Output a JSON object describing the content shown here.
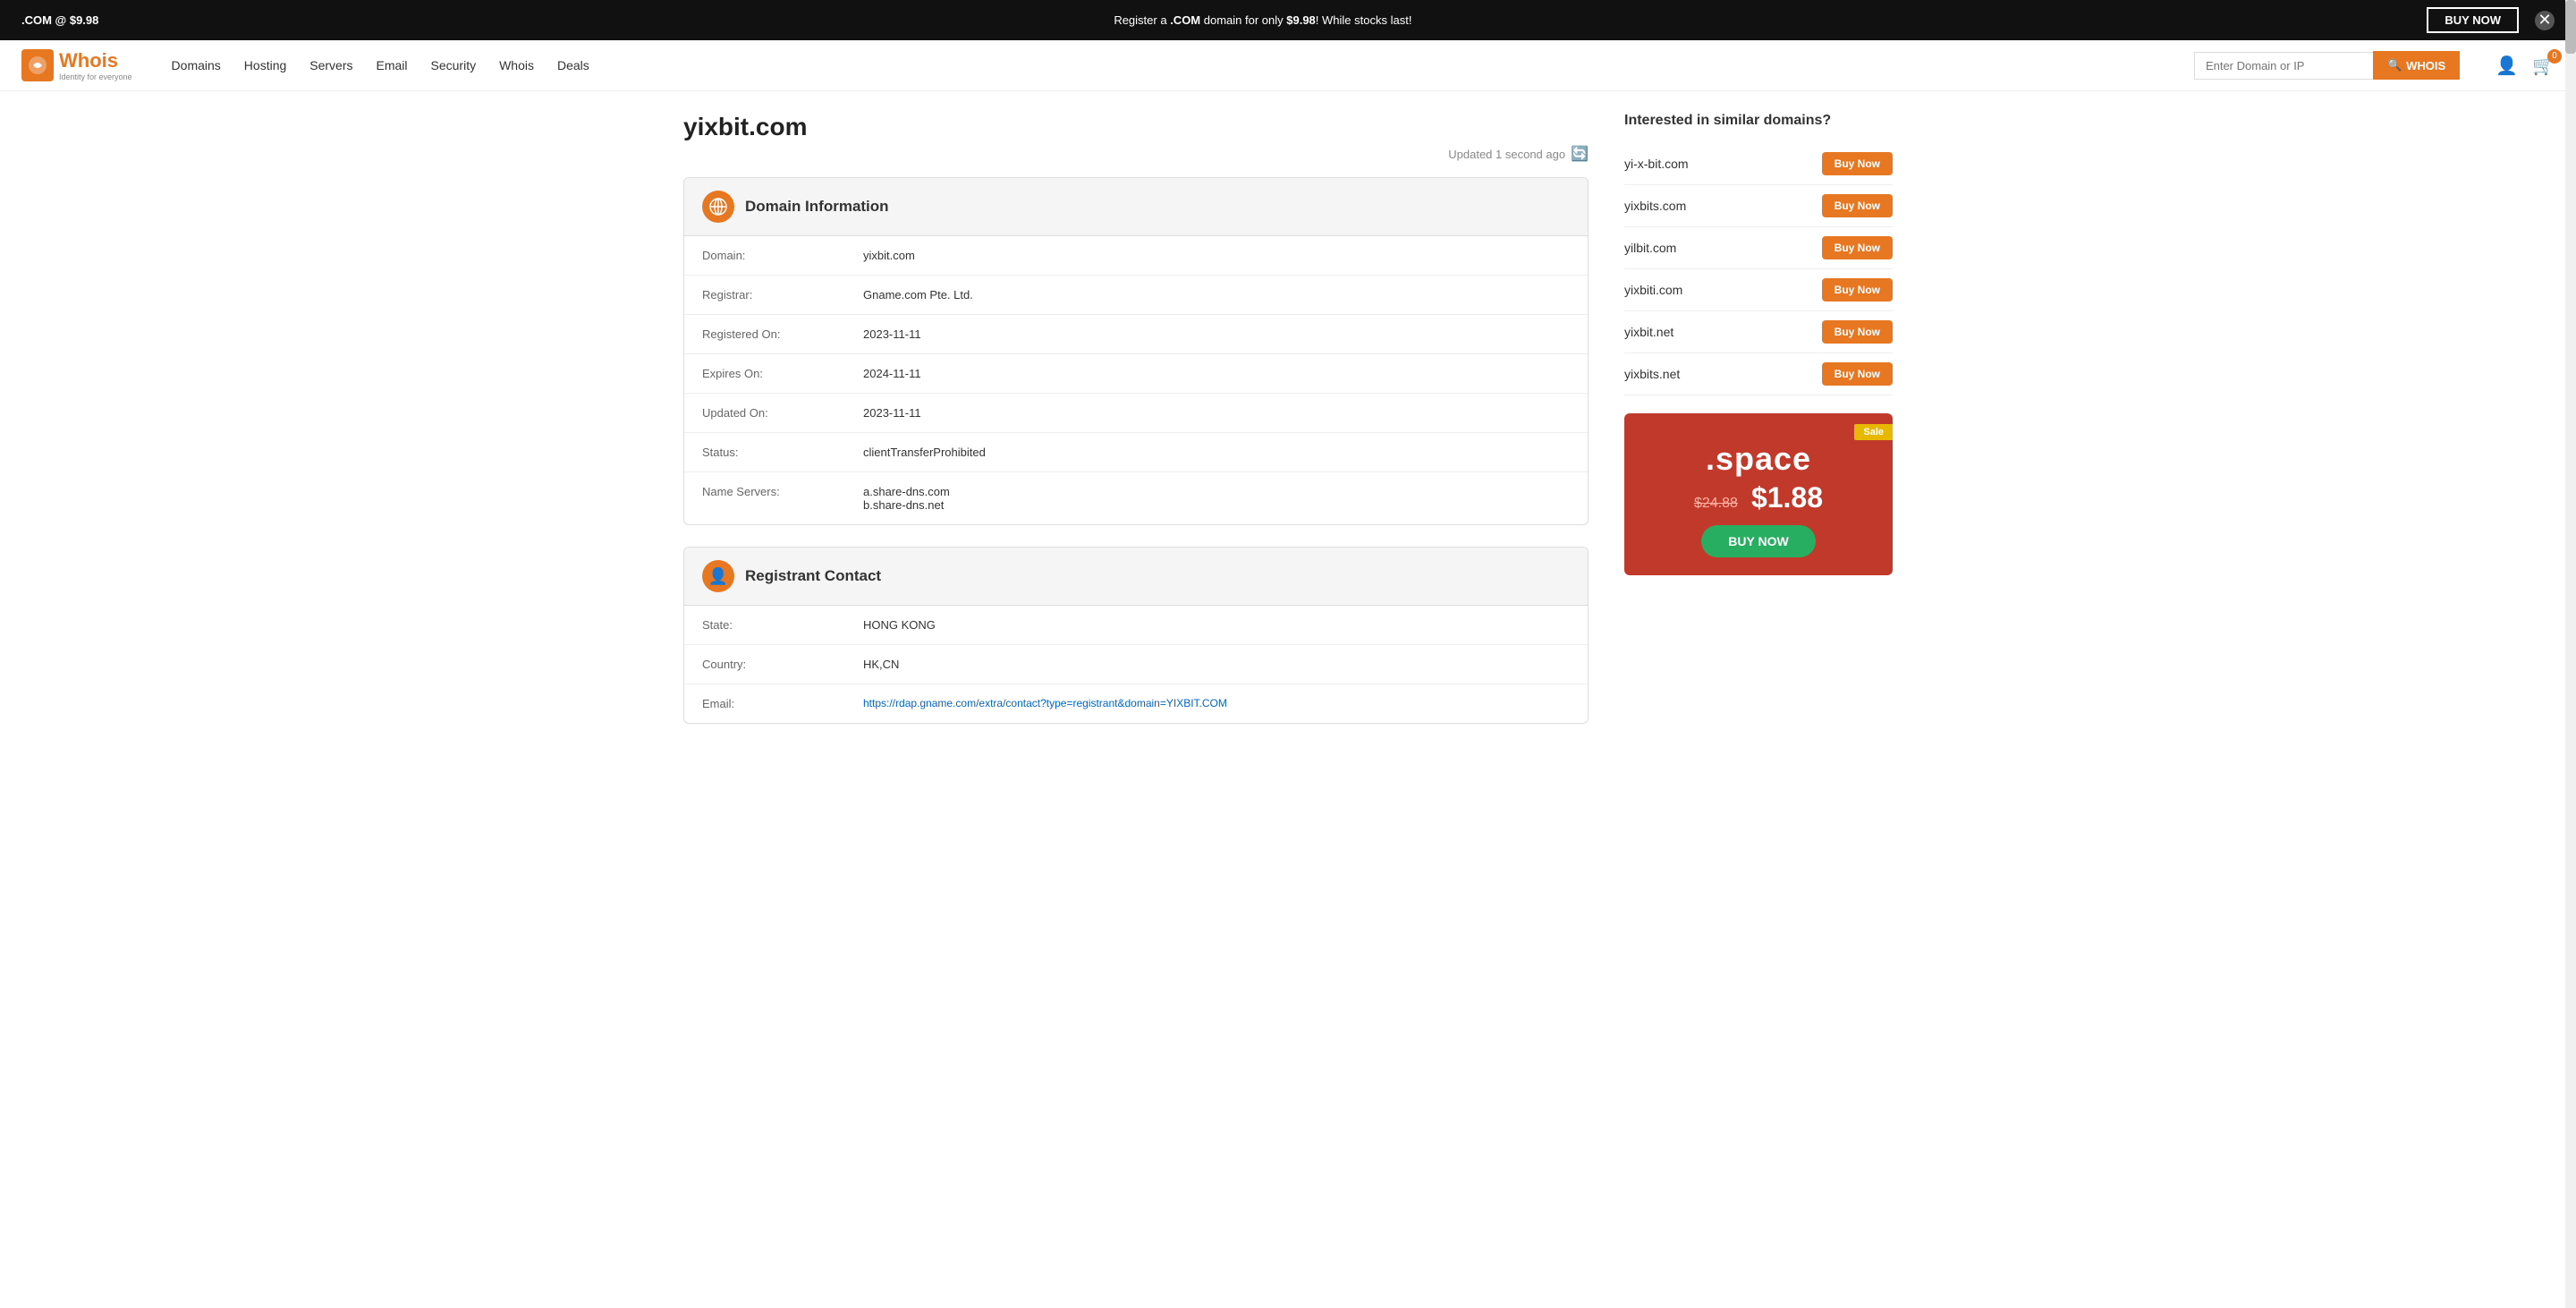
{
  "banner": {
    "left_text": ".COM @ $9.98",
    "center_text_before": "Register a ",
    "center_highlight": ".COM",
    "center_text_after": " domain for only ",
    "center_price": "$9.98",
    "center_text_end": "! While stocks last!",
    "buy_now_label": "BUY NOW",
    "close_label": "✕"
  },
  "header": {
    "logo_text": "Whois",
    "logo_sub": "Identity for everyone",
    "nav": [
      "Domains",
      "Hosting",
      "Servers",
      "Email",
      "Security",
      "Whois",
      "Deals"
    ],
    "search_placeholder": "Enter Domain or IP",
    "search_button_label": "WHOIS",
    "cart_count": "0"
  },
  "page": {
    "domain_title": "yixbit.com",
    "updated_text": "Updated 1 second ago"
  },
  "domain_info": {
    "card_title": "Domain Information",
    "rows": [
      {
        "label": "Domain:",
        "value": "yixbit.com"
      },
      {
        "label": "Registrar:",
        "value": "Gname.com Pte. Ltd."
      },
      {
        "label": "Registered On:",
        "value": "2023-11-11"
      },
      {
        "label": "Expires On:",
        "value": "2024-11-11"
      },
      {
        "label": "Updated On:",
        "value": "2023-11-11"
      },
      {
        "label": "Status:",
        "value": "clientTransferProhibited"
      },
      {
        "label": "Name Servers:",
        "value": "a.share-dns.com\nb.share-dns.net"
      }
    ]
  },
  "registrant_contact": {
    "card_title": "Registrant Contact",
    "rows": [
      {
        "label": "State:",
        "value": "HONG KONG"
      },
      {
        "label": "Country:",
        "value": "HK,CN"
      },
      {
        "label": "Email:",
        "value": "https://rdap.gname.com/extra/contact?type=registrant&domain=YIXBIT.COM"
      }
    ]
  },
  "similar_domains": {
    "title": "Interested in similar domains?",
    "items": [
      {
        "domain": "yi-x-bit.com",
        "btn": "Buy Now"
      },
      {
        "domain": "yixbits.com",
        "btn": "Buy Now"
      },
      {
        "domain": "yilbit.com",
        "btn": "Buy Now"
      },
      {
        "domain": "yixbiti.com",
        "btn": "Buy Now"
      },
      {
        "domain": "yixbit.net",
        "btn": "Buy Now"
      },
      {
        "domain": "yixbits.net",
        "btn": "Buy Now"
      }
    ]
  },
  "sale_card": {
    "badge": "Sale",
    "tld": ".space",
    "old_price": "$24.88",
    "new_price": "$1.88",
    "buy_label": "BUY NOW"
  }
}
